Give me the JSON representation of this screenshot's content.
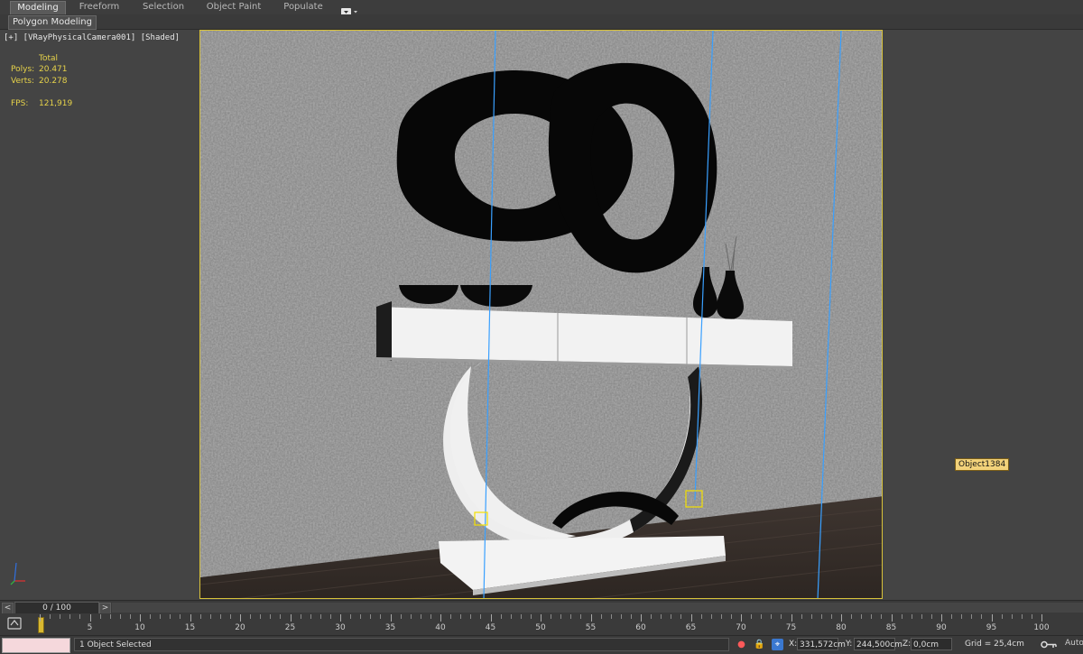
{
  "ribbon": {
    "tabs": [
      {
        "label": "Modeling",
        "active": true
      },
      {
        "label": "Freeform"
      },
      {
        "label": "Selection"
      },
      {
        "label": "Object Paint"
      },
      {
        "label": "Populate"
      }
    ],
    "dropdown_icon": "display-options-icon"
  },
  "subribbon": {
    "label": "Polygon Modeling"
  },
  "viewport": {
    "label": "[+] [VRayPhysicalCamera001] [Shaded]",
    "stats": {
      "total_label": "Total",
      "polys_label": "Polys:",
      "polys_value": "20.471",
      "verts_label": "Verts:",
      "verts_value": "20.278",
      "fps_label": "FPS:",
      "fps_value": "121,919"
    },
    "selected_object_label": "Object1384",
    "frame_color": "#d8c23a",
    "tag_color": "#f2d27a"
  },
  "timeline": {
    "frame_display": "0 / 100",
    "prev": "<",
    "next": ">",
    "ruler_labels": [
      "5",
      "10",
      "15",
      "20",
      "25",
      "30",
      "35",
      "40",
      "45",
      "50",
      "55",
      "60",
      "65",
      "70",
      "75",
      "80",
      "85",
      "90",
      "95",
      "100"
    ]
  },
  "status": {
    "selection_text": "1 Object Selected",
    "x_label": "X:",
    "x_value": "331,572cm",
    "y_label": "Y:",
    "y_value": "244,500cm",
    "z_label": "Z:",
    "z_value": "0,0cm",
    "grid_text": "Grid = 25,4cm",
    "autokey": "Auto"
  }
}
